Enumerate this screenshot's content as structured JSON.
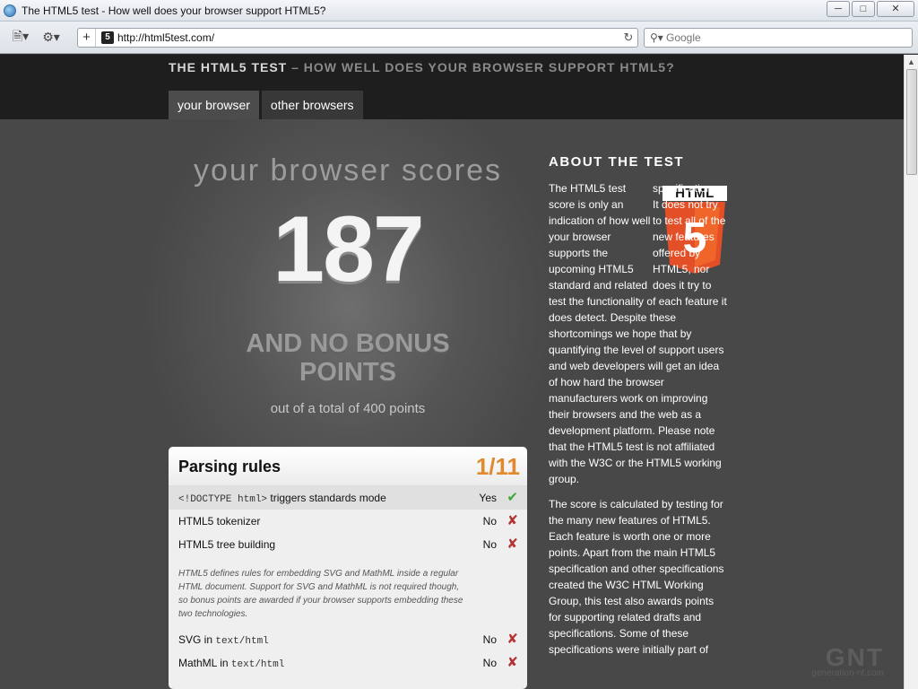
{
  "window": {
    "title": "The HTML5 test - How well does your browser support HTML5?",
    "controls": [
      "minimize",
      "maximize",
      "close"
    ]
  },
  "toolbar": {
    "url": "http://html5test.com/",
    "search_placeholder": "Google"
  },
  "site": {
    "title_main": "THE HTML5 TEST",
    "title_sub": "– HOW WELL DOES YOUR BROWSER SUPPORT HTML5?",
    "tabs": [
      "your browser",
      "other browsers"
    ]
  },
  "score": {
    "heading": "your browser scores",
    "value": "187",
    "bonus_text": "AND NO BONUS POINTS",
    "out_of": "out of a total of 400 points"
  },
  "parsing_panel": {
    "title": "Parsing rules",
    "score": "1/11",
    "rows": [
      {
        "code": "<!DOCTYPE html>",
        "label": " triggers standards mode",
        "result": "Yes",
        "mark": "✔"
      },
      {
        "code": "",
        "label": "HTML5 tokenizer",
        "result": "No",
        "mark": "✘"
      },
      {
        "code": "",
        "label": "HTML5 tree building",
        "result": "No",
        "mark": "✘"
      }
    ],
    "note": "HTML5 defines rules for embedding SVG and MathML inside a regular HTML document. Support for SVG and MathML is not required though, so bonus points are awarded if your browser supports embedding these two technologies.",
    "bonus_rows": [
      {
        "label": "SVG in ",
        "code": "text/html",
        "result": "No",
        "mark": "✘"
      },
      {
        "label": "MathML in ",
        "code": "text/html",
        "result": "No",
        "mark": "✘"
      }
    ]
  },
  "about": {
    "title": "ABOUT THE TEST",
    "badge_text": "HTML",
    "badge_digit": "5",
    "p1_narrow": "The HTML5 test score is only an indication of how well your browser supports the upcoming HTML5 standard and related",
    "p1_rest": "specifications. It does not try to test all of the new features offered by HTML5, nor does it try to test the functionality of each feature it does detect. Despite these shortcomings we hope that by quantifying the level of support users and web developers will get an idea of how hard the browser manufacturers work on improving their browsers and the web as a development platform. Please note that the HTML5 test is not affiliated with the W3C or the HTML5 working group.",
    "p2": "The score is calculated by testing for the many new features of HTML5. Each feature is worth one or more points. Apart from the main HTML5 specification and other specifications created the W3C HTML Working Group, this test also awards points for supporting related drafts and specifications. Some of these specifications were initially part of"
  },
  "watermark": {
    "logo": "GNT",
    "domain": "generation-nt.com"
  },
  "colors": {
    "accent_orange": "#e0892d",
    "yes_green": "#3da63b",
    "no_red": "#b53232",
    "html5_orange": "#e34f26"
  }
}
